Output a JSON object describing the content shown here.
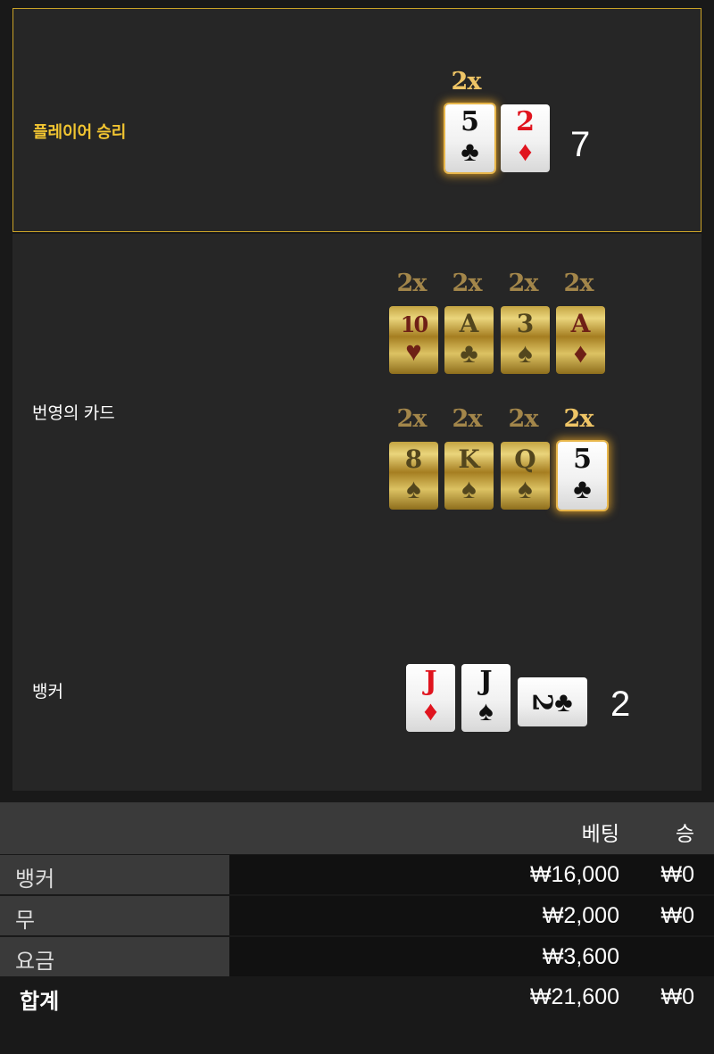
{
  "player": {
    "label": "플레이어 승리",
    "multiplier": "2x",
    "cards": [
      {
        "rank": "5",
        "suit": "♣",
        "color": "black"
      },
      {
        "rank": "2",
        "suit": "♦",
        "color": "red"
      }
    ],
    "score": "7"
  },
  "lucky_cards": {
    "label": "번영의 카드",
    "row1": [
      {
        "mult": "2x",
        "rank": "10",
        "suit": "♥"
      },
      {
        "mult": "2x",
        "rank": "A",
        "suit": "♣"
      },
      {
        "mult": "2x",
        "rank": "3",
        "suit": "♠"
      },
      {
        "mult": "2x",
        "rank": "A",
        "suit": "♦"
      }
    ],
    "row2": [
      {
        "mult": "2x",
        "rank": "8",
        "suit": "♠"
      },
      {
        "mult": "2x",
        "rank": "K",
        "suit": "♠"
      },
      {
        "mult": "2x",
        "rank": "Q",
        "suit": "♠"
      },
      {
        "mult": "2x",
        "rank": "5",
        "suit": "♣"
      }
    ]
  },
  "banker": {
    "label": "뱅커",
    "cards": [
      {
        "rank": "J",
        "suit": "♦",
        "color": "red"
      },
      {
        "rank": "J",
        "suit": "♠",
        "color": "black"
      },
      {
        "rank": "2",
        "suit": "♣",
        "color": "black"
      }
    ],
    "score": "2"
  },
  "summary": {
    "header_bet": "베팅",
    "header_win": "승",
    "rows": [
      {
        "label": "뱅커",
        "bet": "₩16,000",
        "win": "₩0"
      },
      {
        "label": "무",
        "bet": "₩2,000",
        "win": "₩0"
      },
      {
        "label": "요금",
        "bet": "₩3,600",
        "win": ""
      }
    ],
    "total": {
      "label": "합계",
      "bet": "₩21,600",
      "win": "₩0"
    }
  },
  "colors": {
    "gold_border": "#c9a227",
    "player_label": "#f2c531",
    "red_suit": "#e0141e"
  }
}
